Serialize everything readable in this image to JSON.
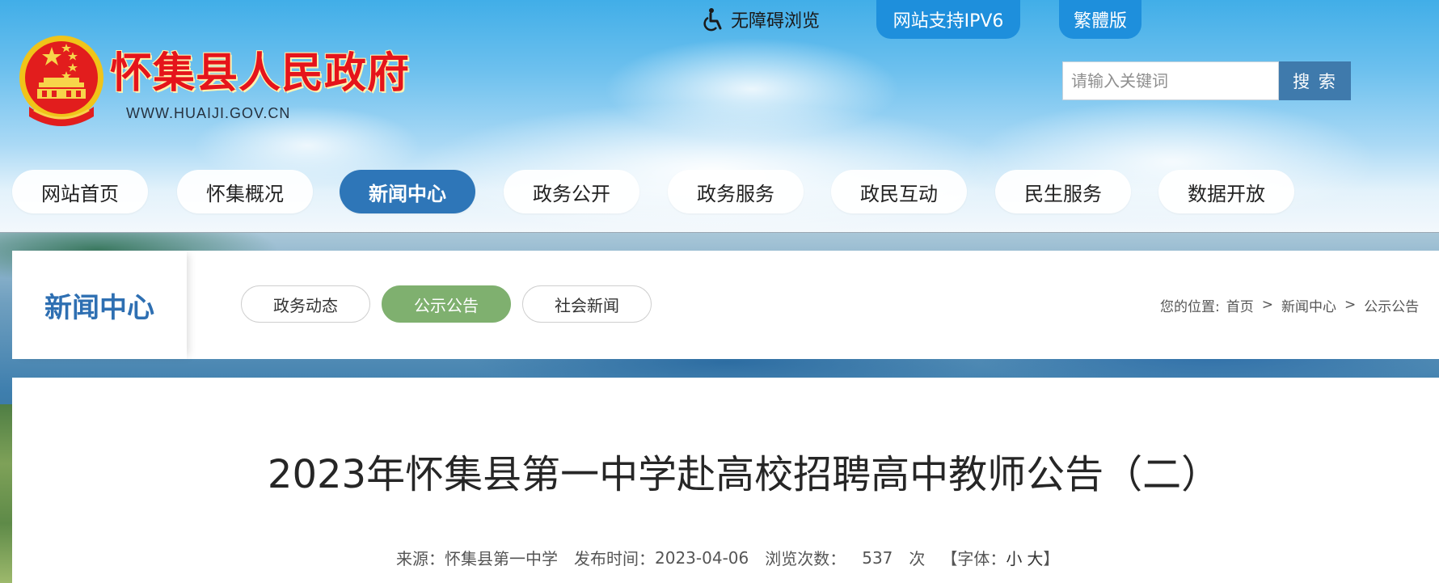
{
  "site": {
    "name": "怀集县人民政府",
    "domain": "WWW.HUAIJI.GOV.CN"
  },
  "top_links": {
    "accessibility": "无障碍浏览",
    "ipv6": "网站支持IPV6",
    "traditional": "繁體版"
  },
  "search": {
    "placeholder": "请输入关键词",
    "button": "搜 索"
  },
  "nav": {
    "items": [
      {
        "label": "网站首页"
      },
      {
        "label": "怀集概况"
      },
      {
        "label": "新闻中心"
      },
      {
        "label": "政务公开"
      },
      {
        "label": "政务服务"
      },
      {
        "label": "政民互动"
      },
      {
        "label": "民生服务"
      },
      {
        "label": "数据开放"
      }
    ],
    "active": "新闻中心"
  },
  "section": {
    "title": "新闻中心",
    "tabs": [
      {
        "label": "政务动态"
      },
      {
        "label": "公示公告"
      },
      {
        "label": "社会新闻"
      }
    ],
    "active_tab": "公示公告"
  },
  "breadcrumb": {
    "prefix": "您的位置:",
    "items": [
      "首页",
      "新闻中心",
      "公示公告"
    ],
    "separator": ">"
  },
  "article": {
    "title": "2023年怀集县第一中学赴高校招聘高中教师公告（二）",
    "source_label": "来源：",
    "source": "怀集县第一中学",
    "date_label": "发布时间：",
    "date": "2023-04-06",
    "views_label": "浏览次数：",
    "views": "537",
    "views_unit": "次",
    "font_label": "【字体：",
    "font_small": "小",
    "font_large": "大",
    "font_close": "】"
  },
  "colors": {
    "brand_red": "#e5141b",
    "nav_active": "#2e76b8",
    "tab_active": "#7fb06f",
    "search_button": "#3f7aac",
    "top_pill": "#1e8fdc"
  }
}
